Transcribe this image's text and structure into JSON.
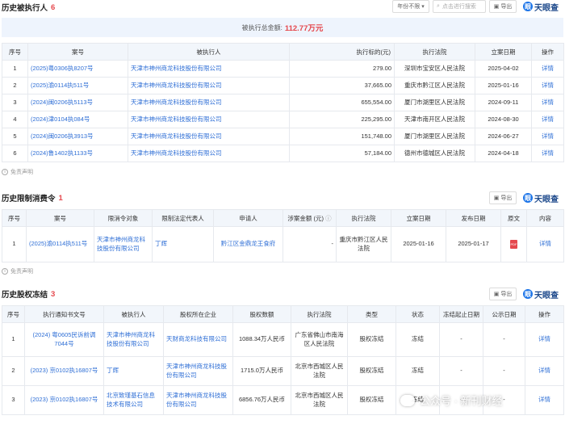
{
  "section1": {
    "title": "历史被执行人",
    "count": "6",
    "year_filter": "年份不限",
    "search_placeholder": "点击进行搜索",
    "export_label": "导出",
    "logo_text": "天眼查",
    "summary_label": "被执行总金额:",
    "summary_amount": "112.77万元",
    "headers": [
      "序号",
      "案号",
      "被执行人",
      "执行标的(元)",
      "执行法院",
      "立案日期",
      "操作"
    ],
    "rows": [
      {
        "no": "1",
        "case": "(2025)粤0306执8207号",
        "party": "天津市神州商龙科技股份有限公司",
        "amount": "279.00",
        "court": "深圳市宝安区人民法院",
        "date": "2025-04-02",
        "action": "详情"
      },
      {
        "no": "2",
        "case": "(2025)渝0114执511号",
        "party": "天津市神州商龙科技股份有限公司",
        "amount": "37,665.00",
        "court": "重庆市黔江区人民法院",
        "date": "2025-01-16",
        "action": "详情"
      },
      {
        "no": "3",
        "case": "(2024)闽0206执5113号",
        "party": "天津市神州商龙科技股份有限公司",
        "amount": "655,554.00",
        "court": "厦门市湖里区人民法院",
        "date": "2024-09-11",
        "action": "详情"
      },
      {
        "no": "4",
        "case": "(2024)津0104执084号",
        "party": "天津市神州商龙科技股份有限公司",
        "amount": "225,295.00",
        "court": "天津市南开区人民法院",
        "date": "2024-08-30",
        "action": "详情"
      },
      {
        "no": "5",
        "case": "(2024)闽0206执3913号",
        "party": "天津市神州商龙科技股份有限公司",
        "amount": "151,748.00",
        "court": "厦门市湖里区人民法院",
        "date": "2024-06-27",
        "action": "详情"
      },
      {
        "no": "6",
        "case": "(2024)鲁1402执1133号",
        "party": "天津市神州商龙科技股份有限公司",
        "amount": "57,184.00",
        "court": "德州市德城区人民法院",
        "date": "2024-04-18",
        "action": "详情"
      }
    ],
    "disclaimer": "免责声明"
  },
  "section2": {
    "title": "历史限制消费令",
    "count": "1",
    "export_label": "导出",
    "logo_text": "天眼查",
    "headers": [
      "序号",
      "案号",
      "限消令对象",
      "限制法定代表人",
      "申请人",
      "涉案金额 (元)",
      "执行法院",
      "立案日期",
      "发布日期",
      "原文",
      "内容"
    ],
    "rows": [
      {
        "no": "1",
        "case": "(2025)渝0114执511号",
        "target": "天津市神州商龙科技股份有限公司",
        "rep": "丁辉",
        "applicant": "黔江区金鼎龙王食府",
        "amount": "-",
        "court": "重庆市黔江区人民法院",
        "filed": "2025-01-16",
        "published": "2025-01-17",
        "doc": "PDF",
        "action": "详情"
      }
    ],
    "disclaimer": "免责声明"
  },
  "section3": {
    "title": "历史股权冻结",
    "count": "3",
    "export_label": "导出",
    "logo_text": "天眼查",
    "headers": [
      "序号",
      "执行通知书文号",
      "被执行人",
      "股权所在企业",
      "股权数额",
      "执行法院",
      "类型",
      "状态",
      "冻结起止日期",
      "公示日期",
      "操作"
    ],
    "rows": [
      {
        "no": "1",
        "doc_no": "(2024) 粤0605民诉前调7044号",
        "party": "天津市神州商龙科技股份有限公司",
        "company": "天财商龙科技有限公司",
        "shares": "1088.34万人民币",
        "court": "广东省佛山市南海区人民法院",
        "type": "股权冻结",
        "status": "冻结",
        "period": "-",
        "pub": "-",
        "action": "详情"
      },
      {
        "no": "2",
        "doc_no": "(2023) 京0102执16807号",
        "party": "丁辉",
        "company": "天津市神州商龙科技股份有限公司",
        "shares": "1715.0万人民币",
        "court": "北京市西城区人民法院",
        "type": "股权冻结",
        "status": "冻结",
        "period": "-",
        "pub": "-",
        "action": "详情"
      },
      {
        "no": "3",
        "doc_no": "(2023) 京0102执16807号",
        "party": "北京致瑾基石信息技术有限公司",
        "company": "天津市神州商龙科技股份有限公司",
        "shares": "6856.76万人民币",
        "court": "北京市西城区人民法院",
        "type": "股权冻结",
        "status": "冻结",
        "period": "-",
        "pub": "-",
        "action": "详情"
      }
    ]
  },
  "watermark": "公众号 · 新刊财经"
}
